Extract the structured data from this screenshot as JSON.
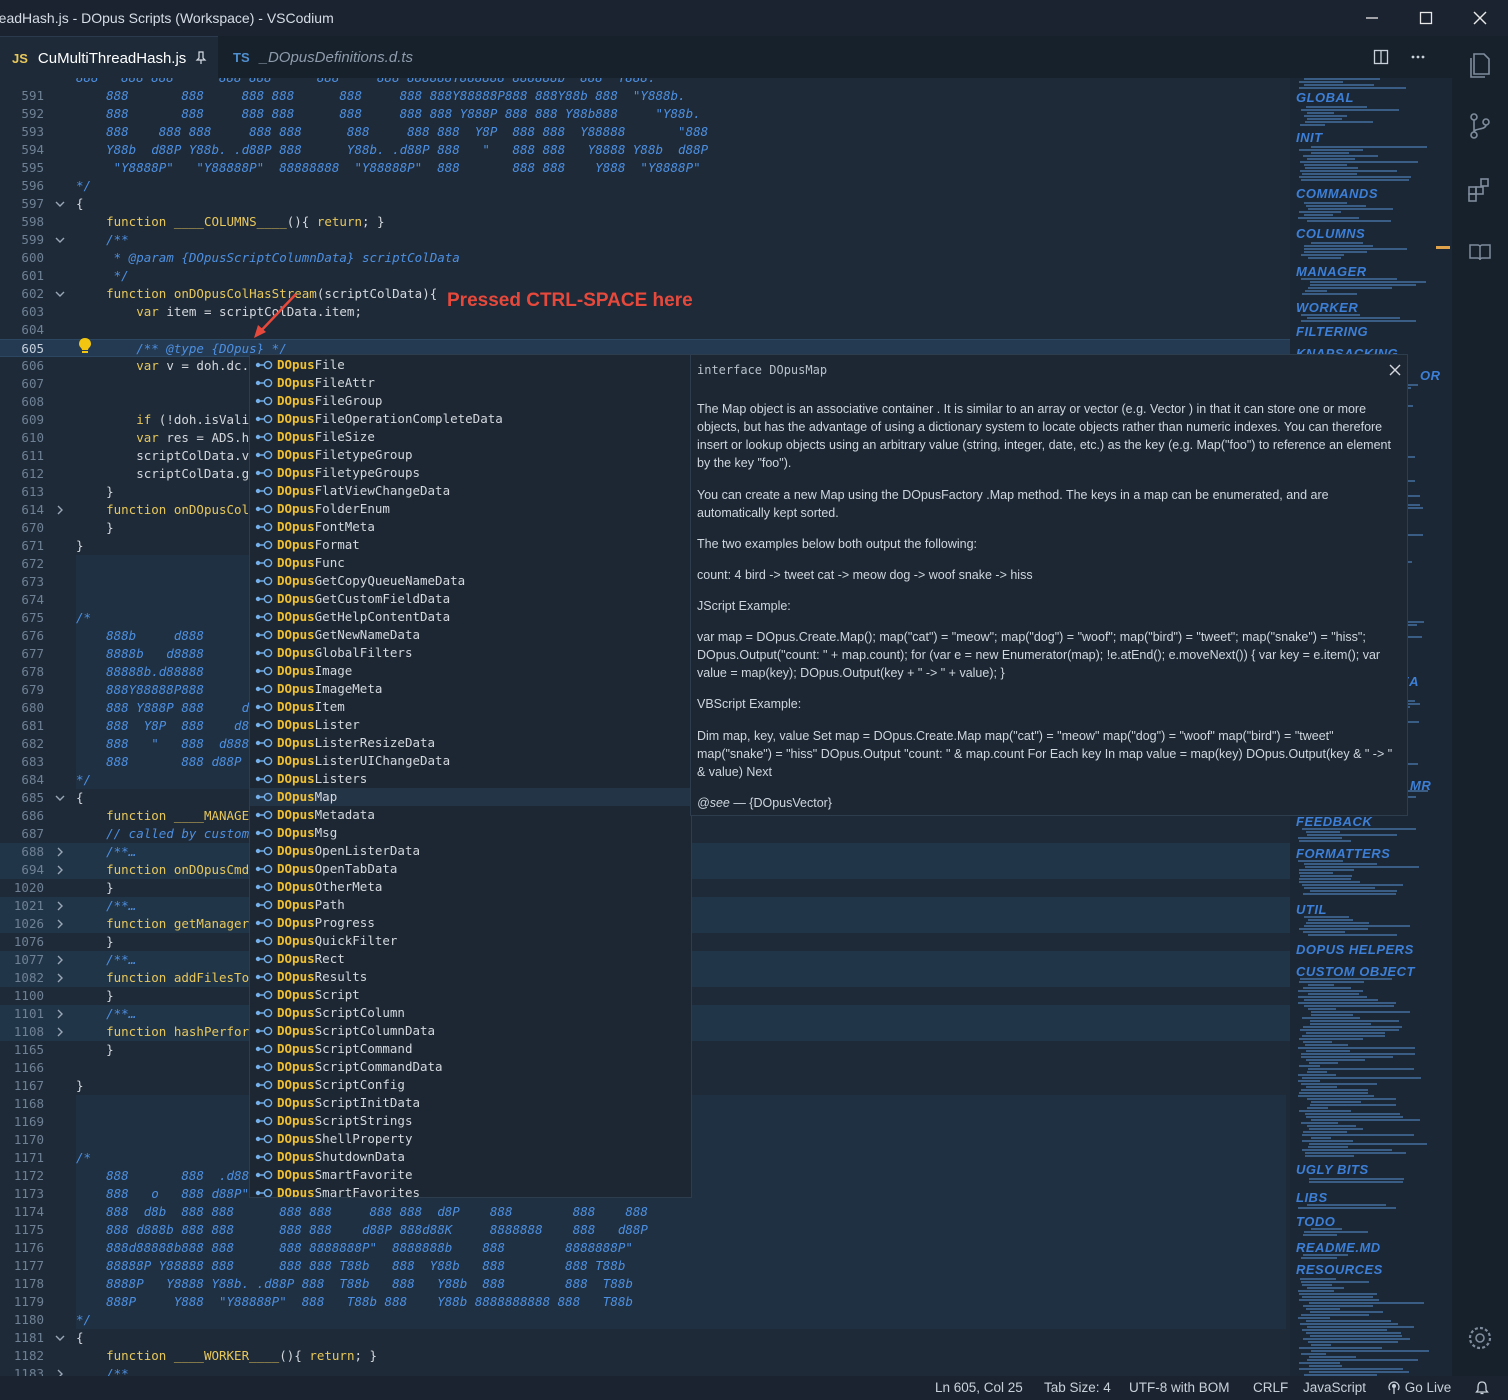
{
  "window": {
    "title": "readHash.js - DOpus Scripts (Workspace) - VSCodium"
  },
  "tabs": [
    {
      "lang": "JS",
      "label": "CuMultiThreadHash.js"
    },
    {
      "lang": "TS",
      "label": "_DOpusDefinitions.d.ts"
    }
  ],
  "editor": {
    "lines": [
      {
        "n": "",
        "fold": "",
        "code": [
          [
            "cm",
            "888   888 888      888 888      888     888 888888Y888888 888888b  888  Y888."
          ]
        ]
      },
      {
        "n": "591",
        "fold": "",
        "code": [
          [
            "cm",
            "    888       888     888 888      888     888 888Y88888P888 888Y88b 888  \"Y888b."
          ]
        ]
      },
      {
        "n": "592",
        "fold": "",
        "code": [
          [
            "cm",
            "    888       888     888 888      888     888 888 Y888P 888 888 Y88b888     \"Y88b."
          ]
        ]
      },
      {
        "n": "593",
        "fold": "",
        "code": [
          [
            "cm",
            "    888    888 888     888 888      888     888 888  Y8P  888 888  Y88888       \"888"
          ]
        ]
      },
      {
        "n": "594",
        "fold": "",
        "code": [
          [
            "cm",
            "    Y88b  d88P Y88b. .d88P 888      Y88b. .d88P 888   \"   888 888   Y8888 Y88b  d88P"
          ]
        ]
      },
      {
        "n": "595",
        "fold": "",
        "code": [
          [
            "cm",
            "     \"Y8888P\"   \"Y88888P\"  88888888  \"Y88888P\"  888       888 888    Y888  \"Y8888P\""
          ]
        ]
      },
      {
        "n": "596",
        "fold": "",
        "code": [
          [
            "cm",
            "*/"
          ]
        ]
      },
      {
        "n": "597",
        "fold": "v",
        "code": [
          [
            "tx",
            "{"
          ]
        ]
      },
      {
        "n": "598",
        "fold": "",
        "code": [
          [
            "kw",
            "    function "
          ],
          [
            "fn",
            "____COLUMNS____"
          ],
          [
            "tx",
            "(){ "
          ],
          [
            "kw",
            "return"
          ],
          [
            "tx",
            "; }"
          ]
        ]
      },
      {
        "n": "599",
        "fold": "v",
        "code": [
          [
            "cm",
            "    /**"
          ]
        ]
      },
      {
        "n": "600",
        "fold": "",
        "code": [
          [
            "cm",
            "     * @param {DOpusScriptColumnData} scriptColData"
          ]
        ]
      },
      {
        "n": "601",
        "fold": "",
        "code": [
          [
            "cm",
            "     */"
          ]
        ]
      },
      {
        "n": "602",
        "fold": "v",
        "code": [
          [
            "kw",
            "    function "
          ],
          [
            "fn",
            "onDOpusColHasStream"
          ],
          [
            "tx",
            "(scriptColData){"
          ]
        ]
      },
      {
        "n": "603",
        "fold": "",
        "code": [
          [
            "kw",
            "        var "
          ],
          [
            "tx",
            "item = scriptColData.item;"
          ]
        ]
      },
      {
        "n": "604",
        "fold": "",
        "code": [
          [
            "tx",
            ""
          ]
        ]
      },
      {
        "n": "605",
        "fold": "",
        "code": [
          [
            "cm",
            "        /** @type {DOpus} */"
          ]
        ]
      },
      {
        "n": "606",
        "fold": "",
        "code": [
          [
            "kw",
            "        var "
          ],
          [
            "tx",
            "v = doh.dc.M"
          ]
        ]
      },
      {
        "n": "607",
        "fold": "",
        "code": [
          [
            "tx",
            ""
          ]
        ]
      },
      {
        "n": "608",
        "fold": "",
        "code": [
          [
            "tx",
            ""
          ]
        ]
      },
      {
        "n": "609",
        "fold": "",
        "code": [
          [
            "kw",
            "        if "
          ],
          [
            "tx",
            "(!doh.isValid"
          ]
        ]
      },
      {
        "n": "610",
        "fold": "",
        "code": [
          [
            "kw",
            "        var "
          ],
          [
            "tx",
            "res = ADS.ha"
          ]
        ]
      },
      {
        "n": "611",
        "fold": "",
        "code": [
          [
            "tx",
            "        scriptColData.va"
          ]
        ]
      },
      {
        "n": "612",
        "fold": "",
        "code": [
          [
            "tx",
            "        scriptColData.gr"
          ]
        ]
      },
      {
        "n": "613",
        "fold": "",
        "code": [
          [
            "tx",
            "    }"
          ]
        ]
      },
      {
        "n": "614",
        "fold": ">",
        "code": [
          [
            "kw",
            "    function "
          ],
          [
            "fn",
            "onDOpusColM"
          ]
        ]
      },
      {
        "n": "670",
        "fold": "",
        "code": [
          [
            "tx",
            "    }"
          ]
        ]
      },
      {
        "n": "671",
        "fold": "",
        "code": [
          [
            "tx",
            "}"
          ]
        ]
      },
      {
        "n": "672",
        "fold": "",
        "code": [
          [
            "tx",
            ""
          ]
        ]
      },
      {
        "n": "673",
        "fold": "",
        "code": [
          [
            "tx",
            ""
          ]
        ]
      },
      {
        "n": "674",
        "fold": "",
        "code": [
          [
            "tx",
            ""
          ]
        ]
      },
      {
        "n": "675",
        "fold": "",
        "code": [
          [
            "cm",
            "/*"
          ]
        ]
      },
      {
        "n": "676",
        "fold": "",
        "code": [
          [
            "cm",
            "    888b     d888"
          ]
        ]
      },
      {
        "n": "677",
        "fold": "",
        "code": [
          [
            "cm",
            "    8888b   d8888"
          ]
        ]
      },
      {
        "n": "678",
        "fold": "",
        "code": [
          [
            "cm",
            "    88888b.d88888       d"
          ]
        ]
      },
      {
        "n": "679",
        "fold": "",
        "code": [
          [
            "cm",
            "    888Y88888P888      d8"
          ]
        ]
      },
      {
        "n": "680",
        "fold": "",
        "code": [
          [
            "cm",
            "    888 Y888P 888     d8"
          ]
        ]
      },
      {
        "n": "681",
        "fold": "",
        "code": [
          [
            "cm",
            "    888  Y8P  888    d88P"
          ]
        ]
      },
      {
        "n": "682",
        "fold": "",
        "code": [
          [
            "cm",
            "    888   \"   888  d8888"
          ]
        ]
      },
      {
        "n": "683",
        "fold": "",
        "code": [
          [
            "cm",
            "    888       888 d88P"
          ]
        ]
      },
      {
        "n": "684",
        "fold": "",
        "code": [
          [
            "cm",
            "*/"
          ]
        ]
      },
      {
        "n": "685",
        "fold": "v",
        "code": [
          [
            "tx",
            "{"
          ]
        ]
      },
      {
        "n": "686",
        "fold": "",
        "code": [
          [
            "kw",
            "    function "
          ],
          [
            "fn",
            "____MANAGER"
          ]
        ]
      },
      {
        "n": "687",
        "fold": "",
        "code": [
          [
            "cm",
            "    // called by custom"
          ]
        ]
      },
      {
        "n": "688",
        "fold": ">",
        "code": [
          [
            "cm",
            "    /**…"
          ]
        ]
      },
      {
        "n": "694",
        "fold": ">",
        "code": [
          [
            "kw",
            "    function "
          ],
          [
            "fn",
            "onDOpusCmdM"
          ]
        ]
      },
      {
        "n": "1020",
        "fold": "",
        "code": [
          [
            "tx",
            "    }"
          ]
        ]
      },
      {
        "n": "1021",
        "fold": ">",
        "code": [
          [
            "cm",
            "    /**…"
          ]
        ]
      },
      {
        "n": "1026",
        "fold": ">",
        "code": [
          [
            "kw",
            "    function "
          ],
          [
            "fn",
            "getManagerC"
          ]
        ]
      },
      {
        "n": "1076",
        "fold": "",
        "code": [
          [
            "tx",
            "    }"
          ]
        ]
      },
      {
        "n": "1077",
        "fold": ">",
        "code": [
          [
            "cm",
            "    /**…"
          ]
        ]
      },
      {
        "n": "1082",
        "fold": ">",
        "code": [
          [
            "kw",
            "    function "
          ],
          [
            "fn",
            "addFilesToC"
          ]
        ]
      },
      {
        "n": "1100",
        "fold": "",
        "code": [
          [
            "tx",
            "    }"
          ]
        ]
      },
      {
        "n": "1101",
        "fold": ">",
        "code": [
          [
            "cm",
            "    /**…"
          ]
        ]
      },
      {
        "n": "1108",
        "fold": ">",
        "code": [
          [
            "kw",
            "    function "
          ],
          [
            "fn",
            "hashPerform"
          ]
        ]
      },
      {
        "n": "1165",
        "fold": "",
        "code": [
          [
            "tx",
            "    }"
          ]
        ]
      },
      {
        "n": "1166",
        "fold": "",
        "code": [
          [
            "tx",
            ""
          ]
        ]
      },
      {
        "n": "1167",
        "fold": "",
        "code": [
          [
            "tx",
            "}"
          ]
        ]
      },
      {
        "n": "1168",
        "fold": "",
        "code": [
          [
            "tx",
            ""
          ]
        ]
      },
      {
        "n": "1169",
        "fold": "",
        "code": [
          [
            "tx",
            ""
          ]
        ]
      },
      {
        "n": "1170",
        "fold": "",
        "code": [
          [
            "tx",
            ""
          ]
        ]
      },
      {
        "n": "1171",
        "fold": "",
        "code": [
          [
            "cm",
            "/*"
          ]
        ]
      },
      {
        "n": "1172",
        "fold": "",
        "code": [
          [
            "cm",
            "    888       888  .d888"
          ]
        ]
      },
      {
        "n": "1173",
        "fold": "",
        "code": [
          [
            "cm",
            "    888   o   888 d88P\""
          ]
        ]
      },
      {
        "n": "1174",
        "fold": "",
        "code": [
          [
            "cm",
            "    888  d8b  888 888      888 888     888 888  d8P    888        888    888"
          ]
        ]
      },
      {
        "n": "1175",
        "fold": "",
        "code": [
          [
            "cm",
            "    888 d888b 888 888      888 888    d88P 888d88K     8888888    888   d88P"
          ]
        ]
      },
      {
        "n": "1176",
        "fold": "",
        "code": [
          [
            "cm",
            "    888d88888b888 888      888 8888888P\"  8888888b    888        8888888P\""
          ]
        ]
      },
      {
        "n": "1177",
        "fold": "",
        "code": [
          [
            "cm",
            "    88888P Y88888 888      888 888 T88b   888  Y88b   888        888 T88b"
          ]
        ]
      },
      {
        "n": "1178",
        "fold": "",
        "code": [
          [
            "cm",
            "    8888P   Y8888 Y88b. .d88P 888  T88b   888   Y88b  888        888  T88b"
          ]
        ]
      },
      {
        "n": "1179",
        "fold": "",
        "code": [
          [
            "cm",
            "    888P     Y888  \"Y88888P\"  888   T88b 888    Y88b 8888888888 888   T88b"
          ]
        ]
      },
      {
        "n": "1180",
        "fold": "",
        "code": [
          [
            "cm",
            "*/"
          ]
        ]
      },
      {
        "n": "1181",
        "fold": "v",
        "code": [
          [
            "tx",
            "{"
          ]
        ]
      },
      {
        "n": "1182",
        "fold": "",
        "code": [
          [
            "kw",
            "    function "
          ],
          [
            "fn",
            "____WORKER____"
          ],
          [
            "tx",
            "(){ "
          ],
          [
            "kw",
            "return"
          ],
          [
            "tx",
            "; }"
          ]
        ]
      },
      {
        "n": "1183",
        "fold": ">",
        "code": [
          [
            "cm",
            "    /**…"
          ]
        ]
      }
    ]
  },
  "annotation": "Pressed CTRL-SPACE here",
  "suggest": {
    "prefix": "DOpus",
    "items": [
      "File",
      "FileAttr",
      "FileGroup",
      "FileOperationCompleteData",
      "FileSize",
      "FiletypeGroup",
      "FiletypeGroups",
      "FlatViewChangeData",
      "FolderEnum",
      "FontMeta",
      "Format",
      "Func",
      "GetCopyQueueNameData",
      "GetCustomFieldData",
      "GetHelpContentData",
      "GetNewNameData",
      "GlobalFilters",
      "Image",
      "ImageMeta",
      "Item",
      "Lister",
      "ListerResizeData",
      "ListerUIChangeData",
      "Listers",
      "Map",
      "Metadata",
      "Msg",
      "OpenListerData",
      "OpenTabData",
      "OtherMeta",
      "Path",
      "Progress",
      "QuickFilter",
      "Rect",
      "Results",
      "Script",
      "ScriptColumn",
      "ScriptColumnData",
      "ScriptCommand",
      "ScriptCommandData",
      "ScriptConfig",
      "ScriptInitData",
      "ScriptStrings",
      "ShellProperty",
      "ShutdownData",
      "SmartFavorite",
      "SmartFavorites"
    ],
    "selected": "Map"
  },
  "details": {
    "signature": "interface DOpusMap",
    "paragraphs": [
      "The Map object is an associative container . It is similar to an array or vector (e.g. Vector ) in that it can store one or more objects, but has the advantage of using a dictionary system to locate objects rather than numeric indexes. You can therefore insert or lookup objects using an arbitrary value (string, integer, date, etc.) as the key (e.g. Map(\"foo\") to reference an element by the key \"foo\").",
      "You can create a new Map using the DOpusFactory .Map method. The keys in a map can be enumerated, and are automatically kept sorted.",
      "The two examples below both output the following:",
      "count: 4 bird -> tweet cat -> meow dog -> woof snake -> hiss",
      "JScript Example:",
      "var map = DOpus.Create.Map(); map(\"cat\") = \"meow\"; map(\"dog\") = \"woof\"; map(\"bird\") = \"tweet\"; map(\"snake\") = \"hiss\"; DOpus.Output(\"count: \" + map.count); for (var e = new Enumerator(map); !e.atEnd(); e.moveNext()) { var key = e.item(); var value = map(key); DOpus.Output(key + \" -> \" + value); }",
      "VBScript Example:",
      "Dim map, key, value Set map = DOpus.Create.Map map(\"cat\") = \"meow\" map(\"dog\") = \"woof\" map(\"bird\") = \"tweet\" map(\"snake\") = \"hiss\" DOpus.Output \"count: \" & map.count For Each key In map value = map(key) DOpus.Output(key & \" -> \" & value) Next"
    ],
    "see_tag": "@see",
    "see_text": " — {DOpusVector}"
  },
  "minimap": {
    "labels": [
      "GLOBAL",
      "INIT",
      "COMMANDS",
      "COLUMNS",
      "MANAGER",
      "WORKER",
      "FILTERING",
      "KNAPSACKING",
      "OR",
      "EA",
      "MR",
      "FEEDBACK",
      "FORMATTERS",
      "UTIL",
      "DOPUS HELPERS",
      "CUSTOM OBJECT",
      "UGLY BITS",
      "LIBS",
      "TODO",
      "README.MD",
      "RESOURCES"
    ]
  },
  "status": {
    "position": "Ln 605, Col 25",
    "tabsize": "Tab Size: 4",
    "encoding": "UTF-8 with BOM",
    "eol": "CRLF",
    "language": "JavaScript",
    "golive": "Go Live"
  },
  "colors": {
    "accent": "#3d7fd6",
    "comment": "#4d8fe0",
    "keyword": "#e8c85b",
    "annotation": "#e6493c",
    "match": "#f0c030"
  },
  "icons": [
    "pin-icon",
    "split-editor-icon",
    "more-icon",
    "explorer-icon",
    "source-control-icon",
    "extensions-icon",
    "book-icon",
    "settings-icon",
    "bell-icon",
    "lightbulb-icon",
    "broadcast-icon",
    "symbol-interface-icon",
    "close-icon"
  ]
}
